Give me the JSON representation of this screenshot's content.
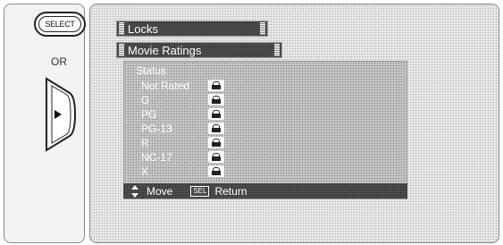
{
  "remote": {
    "select_label": "SELECT",
    "or_label": "OR"
  },
  "menu": {
    "title": "Locks",
    "submenu": "Movie Ratings",
    "section_label": "Status",
    "ratings": [
      {
        "label": "Not Rated",
        "status": "locked"
      },
      {
        "label": "G",
        "status": "locked"
      },
      {
        "label": "PG",
        "status": "locked"
      },
      {
        "label": "PG-13",
        "status": "locked"
      },
      {
        "label": "R",
        "status": "locked"
      },
      {
        "label": "NC-17",
        "status": "locked"
      },
      {
        "label": "X",
        "status": "locked"
      }
    ],
    "help": {
      "move_label": "Move",
      "sel_key": "SEL",
      "return_label": "Return"
    }
  },
  "icons": {
    "lock": "lock-icon",
    "updown": "up-down-arrow-icon",
    "dpad": "right-arrow-icon"
  }
}
